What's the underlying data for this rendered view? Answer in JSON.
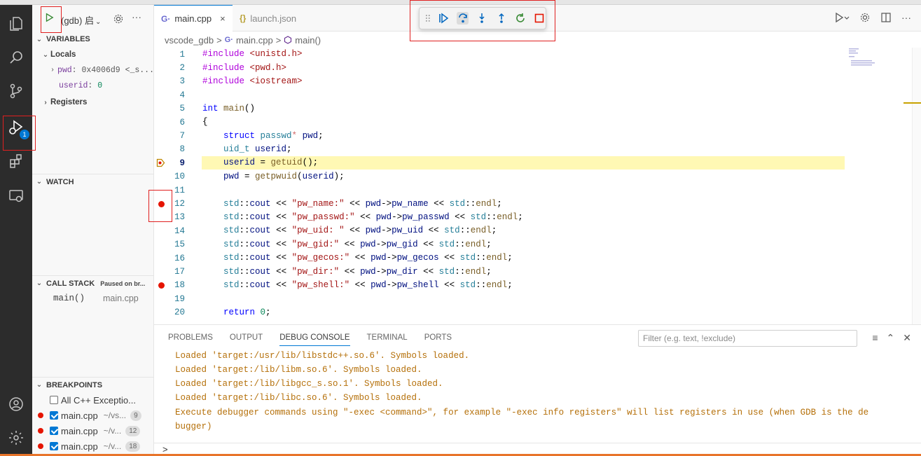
{
  "colors": {
    "accent": "#0078d4",
    "breakpoint": "#e51400",
    "current_line": "#fff8b4",
    "console_text": "#b5700a",
    "annotation": "#e02020"
  },
  "activity_bar": {
    "icons": [
      "explorer-icon",
      "search-icon",
      "source-control-icon",
      "run-debug-icon",
      "extensions-icon",
      "remote-explorer-icon",
      "accounts-icon",
      "settings-gear-icon"
    ],
    "debug_badge": "1"
  },
  "sidebar": {
    "run_config": "(gdb) 启",
    "more": "···",
    "variables_title": "VARIABLES",
    "locals_label": "Locals",
    "vars": [
      {
        "name": "pwd",
        "value": "0x4006d9 <_s..."
      },
      {
        "name": "userid",
        "value": "0"
      }
    ],
    "registers_label": "Registers",
    "watch_title": "WATCH",
    "callstack_title": "CALL STACK",
    "callstack_status": "Paused on br...",
    "frames": [
      {
        "func": "main()",
        "file": "main.cpp"
      }
    ],
    "breakpoints_title": "BREAKPOINTS",
    "exceptions_label": "All C++ Exceptio...",
    "breakpoints": [
      {
        "file": "main.cpp",
        "path": "~/vs...",
        "line": "9"
      },
      {
        "file": "main.cpp",
        "path": "~/v...",
        "line": "12"
      },
      {
        "file": "main.cpp",
        "path": "~/v...",
        "line": "18"
      }
    ]
  },
  "tabs": [
    {
      "label": "main.cpp",
      "icon": "G·",
      "close": "×"
    },
    {
      "label": "launch.json",
      "icon": "{}"
    }
  ],
  "breadcrumb": {
    "folder": "vscode_gdb",
    "sep": ">",
    "file": "main.cpp",
    "symbol": "main()"
  },
  "editor": {
    "current_line": 9,
    "breakpoint_lines": [
      12,
      18
    ],
    "lines": [
      {
        "n": "1",
        "tokens": [
          [
            "pp",
            "#include "
          ],
          [
            "str",
            "<unistd.h>"
          ]
        ]
      },
      {
        "n": "2",
        "tokens": [
          [
            "pp",
            "#include "
          ],
          [
            "str",
            "<pwd.h>"
          ]
        ]
      },
      {
        "n": "3",
        "tokens": [
          [
            "pp",
            "#include "
          ],
          [
            "str",
            "<iostream>"
          ]
        ]
      },
      {
        "n": "4",
        "tokens": []
      },
      {
        "n": "5",
        "tokens": [
          [
            "kw",
            "int "
          ],
          [
            "fn",
            "main"
          ],
          [
            "plain",
            "()"
          ]
        ]
      },
      {
        "n": "6",
        "tokens": [
          [
            "plain",
            "{"
          ]
        ]
      },
      {
        "n": "7",
        "tokens": [
          [
            "plain",
            "    "
          ],
          [
            "kw",
            "struct "
          ],
          [
            "ty",
            "passwd"
          ],
          [
            "ptr",
            "* "
          ],
          [
            "id",
            "pwd"
          ],
          [
            "plain",
            ";"
          ]
        ]
      },
      {
        "n": "8",
        "tokens": [
          [
            "plain",
            "    "
          ],
          [
            "ty",
            "uid_t "
          ],
          [
            "id",
            "userid"
          ],
          [
            "plain",
            ";"
          ]
        ]
      },
      {
        "n": "9",
        "tokens": [
          [
            "plain",
            "    "
          ],
          [
            "id",
            "userid"
          ],
          [
            "plain",
            " = "
          ],
          [
            "fn",
            "getuid"
          ],
          [
            "plain",
            "();"
          ]
        ]
      },
      {
        "n": "10",
        "tokens": [
          [
            "plain",
            "    "
          ],
          [
            "id",
            "pwd"
          ],
          [
            "plain",
            " = "
          ],
          [
            "fn",
            "getpwuid"
          ],
          [
            "plain",
            "("
          ],
          [
            "id",
            "userid"
          ],
          [
            "plain",
            ");"
          ]
        ]
      },
      {
        "n": "11",
        "tokens": []
      },
      {
        "n": "12",
        "tokens": [
          [
            "plain",
            "    "
          ],
          [
            "ty",
            "std"
          ],
          [
            "plain",
            "::"
          ],
          [
            "id",
            "cout"
          ],
          [
            "plain",
            " << "
          ],
          [
            "str",
            "\"pw_name:\""
          ],
          [
            "plain",
            " << "
          ],
          [
            "id",
            "pwd"
          ],
          [
            "plain",
            "->"
          ],
          [
            "id",
            "pw_name"
          ],
          [
            "plain",
            " << "
          ],
          [
            "ty",
            "std"
          ],
          [
            "plain",
            "::"
          ],
          [
            "fn",
            "endl"
          ],
          [
            "plain",
            ";"
          ]
        ]
      },
      {
        "n": "13",
        "tokens": [
          [
            "plain",
            "    "
          ],
          [
            "ty",
            "std"
          ],
          [
            "plain",
            "::"
          ],
          [
            "id",
            "cout"
          ],
          [
            "plain",
            " << "
          ],
          [
            "str",
            "\"pw_passwd:\""
          ],
          [
            "plain",
            " << "
          ],
          [
            "id",
            "pwd"
          ],
          [
            "plain",
            "->"
          ],
          [
            "id",
            "pw_passwd"
          ],
          [
            "plain",
            " << "
          ],
          [
            "ty",
            "std"
          ],
          [
            "plain",
            "::"
          ],
          [
            "fn",
            "endl"
          ],
          [
            "plain",
            ";"
          ]
        ]
      },
      {
        "n": "14",
        "tokens": [
          [
            "plain",
            "    "
          ],
          [
            "ty",
            "std"
          ],
          [
            "plain",
            "::"
          ],
          [
            "id",
            "cout"
          ],
          [
            "plain",
            " << "
          ],
          [
            "str",
            "\"pw_uid: \""
          ],
          [
            "plain",
            " << "
          ],
          [
            "id",
            "pwd"
          ],
          [
            "plain",
            "->"
          ],
          [
            "id",
            "pw_uid"
          ],
          [
            "plain",
            " << "
          ],
          [
            "ty",
            "std"
          ],
          [
            "plain",
            "::"
          ],
          [
            "fn",
            "endl"
          ],
          [
            "plain",
            ";"
          ]
        ]
      },
      {
        "n": "15",
        "tokens": [
          [
            "plain",
            "    "
          ],
          [
            "ty",
            "std"
          ],
          [
            "plain",
            "::"
          ],
          [
            "id",
            "cout"
          ],
          [
            "plain",
            " << "
          ],
          [
            "str",
            "\"pw_gid:\""
          ],
          [
            "plain",
            " << "
          ],
          [
            "id",
            "pwd"
          ],
          [
            "plain",
            "->"
          ],
          [
            "id",
            "pw_gid"
          ],
          [
            "plain",
            " << "
          ],
          [
            "ty",
            "std"
          ],
          [
            "plain",
            "::"
          ],
          [
            "fn",
            "endl"
          ],
          [
            "plain",
            ";"
          ]
        ]
      },
      {
        "n": "16",
        "tokens": [
          [
            "plain",
            "    "
          ],
          [
            "ty",
            "std"
          ],
          [
            "plain",
            "::"
          ],
          [
            "id",
            "cout"
          ],
          [
            "plain",
            " << "
          ],
          [
            "str",
            "\"pw_gecos:\""
          ],
          [
            "plain",
            " << "
          ],
          [
            "id",
            "pwd"
          ],
          [
            "plain",
            "->"
          ],
          [
            "id",
            "pw_gecos"
          ],
          [
            "plain",
            " << "
          ],
          [
            "ty",
            "std"
          ],
          [
            "plain",
            "::"
          ],
          [
            "fn",
            "endl"
          ],
          [
            "plain",
            ";"
          ]
        ]
      },
      {
        "n": "17",
        "tokens": [
          [
            "plain",
            "    "
          ],
          [
            "ty",
            "std"
          ],
          [
            "plain",
            "::"
          ],
          [
            "id",
            "cout"
          ],
          [
            "plain",
            " << "
          ],
          [
            "str",
            "\"pw_dir:\""
          ],
          [
            "plain",
            " << "
          ],
          [
            "id",
            "pwd"
          ],
          [
            "plain",
            "->"
          ],
          [
            "id",
            "pw_dir"
          ],
          [
            "plain",
            " << "
          ],
          [
            "ty",
            "std"
          ],
          [
            "plain",
            "::"
          ],
          [
            "fn",
            "endl"
          ],
          [
            "plain",
            ";"
          ]
        ]
      },
      {
        "n": "18",
        "tokens": [
          [
            "plain",
            "    "
          ],
          [
            "ty",
            "std"
          ],
          [
            "plain",
            "::"
          ],
          [
            "id",
            "cout"
          ],
          [
            "plain",
            " << "
          ],
          [
            "str",
            "\"pw_shell:\""
          ],
          [
            "plain",
            " << "
          ],
          [
            "id",
            "pwd"
          ],
          [
            "plain",
            "->"
          ],
          [
            "id",
            "pw_shell"
          ],
          [
            "plain",
            " << "
          ],
          [
            "ty",
            "std"
          ],
          [
            "plain",
            "::"
          ],
          [
            "fn",
            "endl"
          ],
          [
            "plain",
            ";"
          ]
        ]
      },
      {
        "n": "19",
        "tokens": []
      },
      {
        "n": "20",
        "tokens": [
          [
            "plain",
            "    "
          ],
          [
            "kw",
            "return "
          ],
          [
            "num",
            "0"
          ],
          [
            "plain",
            ";"
          ]
        ]
      }
    ]
  },
  "panel": {
    "tabs": [
      "PROBLEMS",
      "OUTPUT",
      "DEBUG CONSOLE",
      "TERMINAL",
      "PORTS"
    ],
    "active_tab": "DEBUG CONSOLE",
    "filter_placeholder": "Filter (e.g. text, !exclude)",
    "console_lines": [
      "Loaded 'target:/usr/lib/libstdc++.so.6'. Symbols loaded.",
      "Loaded 'target:/lib/libm.so.6'. Symbols loaded.",
      "Loaded 'target:/lib/libgcc_s.so.1'. Symbols loaded.",
      "Loaded 'target:/lib/libc.so.6'. Symbols loaded.",
      "Execute debugger commands using \"-exec <command>\", for example \"-exec info registers\" will list registers in use (when GDB is the de",
      "bugger)"
    ],
    "prompt": ">"
  }
}
